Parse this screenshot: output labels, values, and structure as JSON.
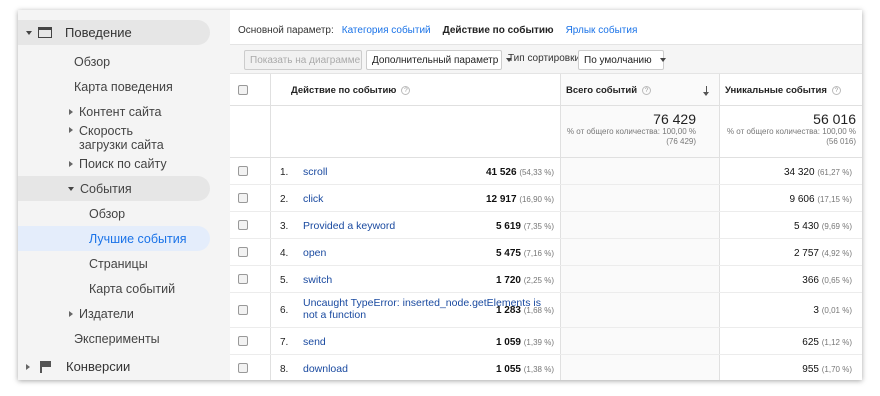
{
  "sidebar": {
    "behavior": "Поведение",
    "overview": "Обзор",
    "behavior_map": "Карта поведения",
    "site_content": "Контент сайта",
    "site_speed": "Скорость загрузки сайта",
    "site_search": "Поиск по сайту",
    "events": "События",
    "events_overview": "Обзор",
    "top_events": "Лучшие события",
    "pages": "Страницы",
    "events_flow": "Карта событий",
    "publishers": "Издатели",
    "experiments": "Эксперименты",
    "conversions": "Конверсии"
  },
  "primary_dimension": {
    "label": "Основной параметр:",
    "options": [
      "Категория событий",
      "Действие по событию",
      "Ярлык события"
    ],
    "active": "Действие по событию"
  },
  "toolbar": {
    "plot_rows": "Показать на диаграмме",
    "secondary_dimension": "Дополнительный параметр",
    "sort_type_label": "Тип сортировки:",
    "sort_type_value": "По умолчанию"
  },
  "table": {
    "headers": {
      "dimension": "Действие по событию",
      "total_events": "Всего событий",
      "unique_events": "Уникальные события"
    },
    "totals": {
      "total_events": "76 429",
      "total_events_sub1": "% от общего количества: 100,00 %",
      "total_events_sub2": "(76 429)",
      "unique_events": "56 016",
      "unique_events_sub1": "% от общего количества: 100,00 %",
      "unique_events_sub2": "(56 016)"
    },
    "rows": [
      {
        "num": "1.",
        "name": "scroll",
        "total": "41 526",
        "total_pct": "(54,33 %)",
        "unique": "34 320",
        "unique_pct": "(61,27 %)"
      },
      {
        "num": "2.",
        "name": "click",
        "total": "12 917",
        "total_pct": "(16,90 %)",
        "unique": "9 606",
        "unique_pct": "(17,15 %)"
      },
      {
        "num": "3.",
        "name": "Provided a keyword",
        "total": "5 619",
        "total_pct": "(7,35 %)",
        "unique": "5 430",
        "unique_pct": "(9,69 %)"
      },
      {
        "num": "4.",
        "name": "open",
        "total": "5 475",
        "total_pct": "(7,16 %)",
        "unique": "2 757",
        "unique_pct": "(4,92 %)"
      },
      {
        "num": "5.",
        "name": "switch",
        "total": "1 720",
        "total_pct": "(2,25 %)",
        "unique": "366",
        "unique_pct": "(0,65 %)"
      },
      {
        "num": "6.",
        "name": "Uncaught TypeError: inserted_node.getElements is not a function",
        "total": "1 283",
        "total_pct": "(1,68 %)",
        "unique": "3",
        "unique_pct": "(0,01 %)"
      },
      {
        "num": "7.",
        "name": "send",
        "total": "1 059",
        "total_pct": "(1,39 %)",
        "unique": "625",
        "unique_pct": "(1,12 %)"
      },
      {
        "num": "8.",
        "name": "download",
        "total": "1 055",
        "total_pct": "(1,38 %)",
        "unique": "955",
        "unique_pct": "(1,70 %)"
      }
    ]
  },
  "icons": {
    "behavior": "window-icon",
    "conversions": "flag-icon",
    "sort": "sort-down-arrow-icon",
    "help": "help-icon"
  }
}
